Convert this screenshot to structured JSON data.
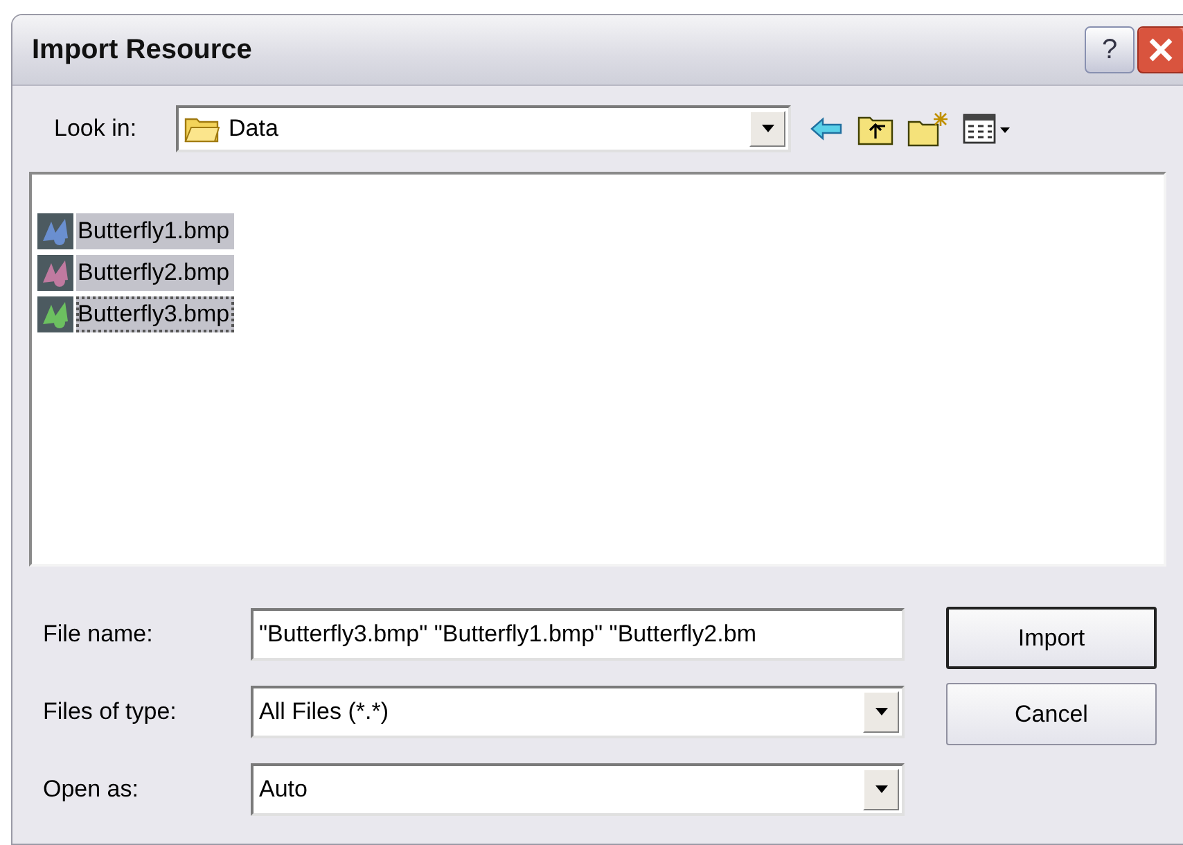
{
  "window": {
    "title": "Import Resource",
    "help_label": "?"
  },
  "look_in": {
    "label": "Look in:",
    "value": "Data"
  },
  "toolbar": [
    {
      "kind": "back"
    },
    {
      "kind": "up"
    },
    {
      "kind": "new_folder"
    },
    {
      "kind": "view_menu"
    }
  ],
  "files": [
    {
      "name": "Butterfly1.bmp",
      "selected": true,
      "focused": false,
      "color": "#6a8fd0"
    },
    {
      "name": "Butterfly2.bmp",
      "selected": true,
      "focused": false,
      "color": "#c07aa0"
    },
    {
      "name": "Butterfly3.bmp",
      "selected": true,
      "focused": true,
      "color": "#6cc060"
    }
  ],
  "fields": [
    {
      "kind": "text",
      "label": "File name:",
      "value": "\"Butterfly3.bmp\" \"Butterfly1.bmp\" \"Butterfly2.bm"
    },
    {
      "kind": "dropdown",
      "label": "Files of type:",
      "value": "All Files (*.*)"
    },
    {
      "kind": "dropdown",
      "label": "Open as:",
      "value": "Auto"
    }
  ],
  "buttons": [
    {
      "label": "Import",
      "default": true
    },
    {
      "label": "Cancel",
      "default": false
    }
  ]
}
